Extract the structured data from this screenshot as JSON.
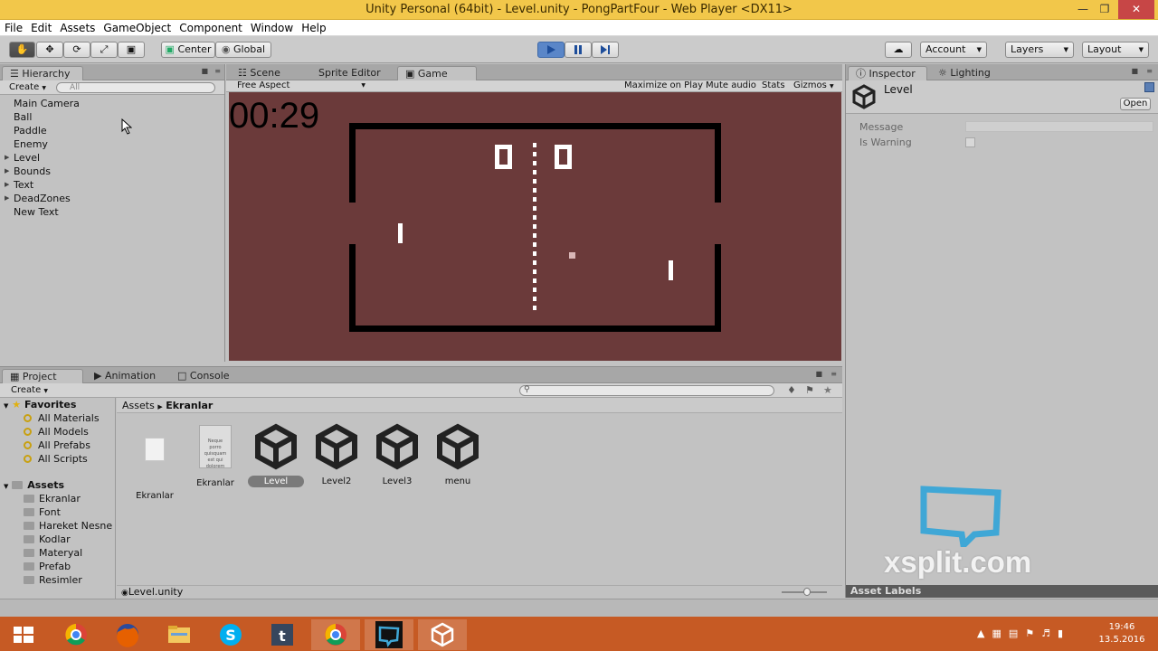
{
  "window": {
    "title": "Unity Personal (64bit) - Level.unity - PongPartFour - Web Player <DX11>"
  },
  "menu": [
    "File",
    "Edit",
    "Assets",
    "GameObject",
    "Component",
    "Window",
    "Help"
  ],
  "toolbar": {
    "center_label": "Center",
    "global_label": "Global",
    "account_label": "Account",
    "layers_label": "Layers",
    "layout_label": "Layout"
  },
  "hierarchy": {
    "tab_label": "Hierarchy",
    "create_label": "Create",
    "search_placeholder": "All",
    "items": [
      {
        "label": "Main Camera",
        "expandable": false
      },
      {
        "label": "Ball",
        "expandable": false
      },
      {
        "label": "Paddle",
        "expandable": false
      },
      {
        "label": "Enemy",
        "expandable": false
      },
      {
        "label": "Level",
        "expandable": true
      },
      {
        "label": "Bounds",
        "expandable": true
      },
      {
        "label": "Text",
        "expandable": true
      },
      {
        "label": "DeadZones",
        "expandable": true
      },
      {
        "label": "New Text",
        "expandable": false
      }
    ]
  },
  "view_tabs": {
    "scene": "Scene",
    "sprite_editor": "Sprite Editor",
    "game": "Game"
  },
  "game_toolbar": {
    "aspect": "Free Aspect",
    "maximize": "Maximize on Play",
    "mute": "Mute audio",
    "stats": "Stats",
    "gizmos": "Gizmos"
  },
  "game": {
    "timer": "00:29",
    "score_left": "0",
    "score_right": "0"
  },
  "inspector": {
    "tab_label": "Inspector",
    "lighting_label": "Lighting",
    "object_name": "Level",
    "open_label": "Open",
    "fields": [
      {
        "label": "Message"
      },
      {
        "label": "Is Warning"
      }
    ]
  },
  "project": {
    "tab_project": "Project",
    "tab_animation": "Animation",
    "tab_console": "Console",
    "create_label": "Create",
    "favorites_label": "Favorites",
    "favorites": [
      "All Materials",
      "All Models",
      "All Prefabs",
      "All Scripts"
    ],
    "assets_label": "Assets",
    "folders": [
      "Ekranlar",
      "Font",
      "Hareket Nesne",
      "Kodlar",
      "Materyal",
      "Prefab",
      "Resimler"
    ],
    "breadcrumb": [
      "Assets",
      "Ekranlar"
    ],
    "assets": [
      {
        "label": "Ekranlar",
        "kind": "file",
        "selected": false
      },
      {
        "label": "Ekranlar",
        "kind": "doc",
        "selected": false
      },
      {
        "label": "Level",
        "kind": "unity",
        "selected": true
      },
      {
        "label": "Level2",
        "kind": "unity",
        "selected": false
      },
      {
        "label": "Level3",
        "kind": "unity",
        "selected": false
      },
      {
        "label": "menu",
        "kind": "unity",
        "selected": false
      }
    ],
    "doc_preview_text": "Neque porro quisquam est qui dolorem",
    "footer_path": "Level.unity"
  },
  "asset_labels": "Asset Labels",
  "watermark": "xsplit.com",
  "taskbar": {
    "time": "19:46",
    "date": "13.5.2016"
  },
  "colors": {
    "title_bar": "#f2c74a",
    "game_bg": "#6b3a3a",
    "taskbar": "#c65a24",
    "play_active": "#5a86c8"
  }
}
